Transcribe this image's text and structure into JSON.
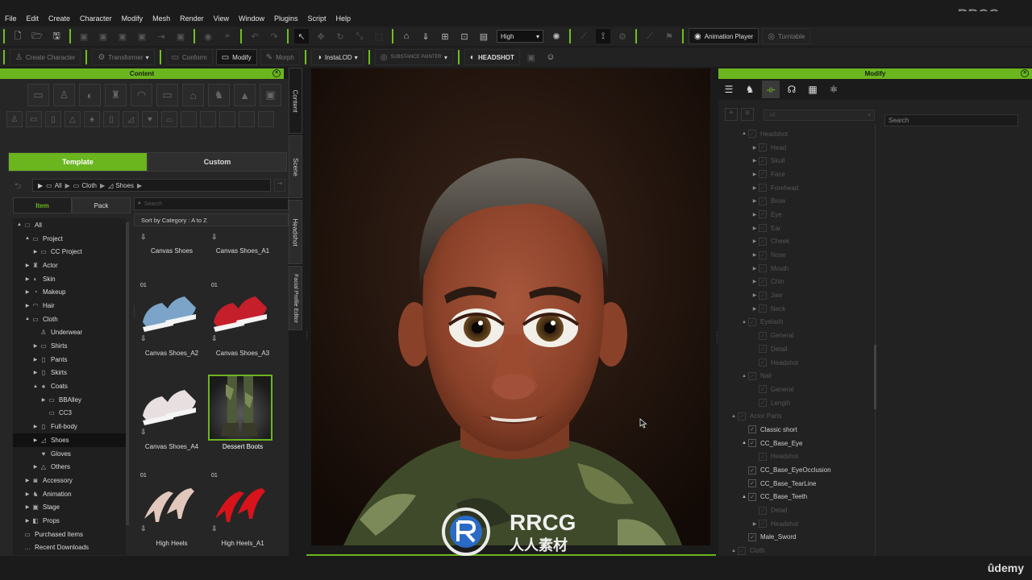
{
  "menu": [
    "File",
    "Edit",
    "Create",
    "Character",
    "Modify",
    "Mesh",
    "Render",
    "View",
    "Window",
    "Plugins",
    "Script",
    "Help"
  ],
  "watermark": "RRCG.cn",
  "toolbar": {
    "quality": "High",
    "animation_player": "Animation Player",
    "turntable": "Turntable",
    "create_character": "Create Character",
    "transformer": "Transformer",
    "conform": "Conform",
    "modify": "Modify",
    "morph": "Morph",
    "instalod": "InstaLOD",
    "substance": "SUBSTANCE PAINTER",
    "headshot": "HEADSHOT"
  },
  "content": {
    "title": "Content",
    "tabs": [
      "Template",
      "Custom"
    ],
    "breadcrumb": [
      "All",
      "Cloth",
      "Shoes"
    ],
    "subtabs": [
      "Item",
      "Pack"
    ],
    "search_placeholder": "Search",
    "sort": "Sort by Category : A to Z",
    "tree": [
      {
        "label": "All",
        "depth": 0,
        "arrow": "▲",
        "icon": "□"
      },
      {
        "label": "Project",
        "depth": 1,
        "arrow": "▲",
        "icon": "▭"
      },
      {
        "label": "CC Project",
        "depth": 2,
        "arrow": "▶",
        "icon": "▭"
      },
      {
        "label": "Actor",
        "depth": 1,
        "arrow": "▶",
        "icon": "♜"
      },
      {
        "label": "Skin",
        "depth": 1,
        "arrow": "▶",
        "icon": "◐"
      },
      {
        "label": "Makeup",
        "depth": 1,
        "arrow": "▶",
        "icon": "◔"
      },
      {
        "label": "Hair",
        "depth": 1,
        "arrow": "▶",
        "icon": "◠"
      },
      {
        "label": "Cloth",
        "depth": 1,
        "arrow": "▲",
        "icon": "▭"
      },
      {
        "label": "Underwear",
        "depth": 2,
        "arrow": "",
        "icon": "♙"
      },
      {
        "label": "Shirts",
        "depth": 2,
        "arrow": "▶",
        "icon": "▭"
      },
      {
        "label": "Pants",
        "depth": 2,
        "arrow": "▶",
        "icon": "▯"
      },
      {
        "label": "Skirts",
        "depth": 2,
        "arrow": "▶",
        "icon": "▯"
      },
      {
        "label": "Coats",
        "depth": 2,
        "arrow": "▲",
        "icon": "♠"
      },
      {
        "label": "BBAlley",
        "depth": 3,
        "arrow": "▶",
        "icon": "▭"
      },
      {
        "label": "CC3",
        "depth": 3,
        "arrow": "",
        "icon": "▭"
      },
      {
        "label": "Full-body",
        "depth": 2,
        "arrow": "▶",
        "icon": "▯"
      },
      {
        "label": "Shoes",
        "depth": 2,
        "arrow": "▶",
        "icon": "◿",
        "selected": true
      },
      {
        "label": "Gloves",
        "depth": 2,
        "arrow": "",
        "icon": "♥"
      },
      {
        "label": "Others",
        "depth": 2,
        "arrow": "▶",
        "icon": "△"
      },
      {
        "label": "Accessory",
        "depth": 1,
        "arrow": "▶",
        "icon": "◙"
      },
      {
        "label": "Animation",
        "depth": 1,
        "arrow": "▶",
        "icon": "♞"
      },
      {
        "label": "Stage",
        "depth": 1,
        "arrow": "▶",
        "icon": "▣"
      },
      {
        "label": "Props",
        "depth": 1,
        "arrow": "▶",
        "icon": "◧"
      },
      {
        "label": "Purchased Items",
        "depth": 0,
        "arrow": "",
        "icon": "▭"
      },
      {
        "label": "Recent Downloads",
        "depth": 0,
        "arrow": "",
        "icon": "…"
      }
    ],
    "items": [
      {
        "label": "Canvas Shoes",
        "num": "",
        "color": "#ddd",
        "col": 0,
        "row": 0
      },
      {
        "label": "Canvas Shoes_A1",
        "num": "",
        "color": "#ddd",
        "col": 1,
        "row": 0
      },
      {
        "label": "Canvas Shoes_A2",
        "num": "01",
        "color": "#7ba4c8",
        "col": 0,
        "row": 1
      },
      {
        "label": "Canvas Shoes_A3",
        "num": "01",
        "color": "#c41f2a",
        "col": 1,
        "row": 1
      },
      {
        "label": "Canvas Shoes_A4",
        "num": "",
        "color": "#e8dfe0",
        "col": 0,
        "row": 2
      },
      {
        "label": "Dessert Boots",
        "num": "",
        "color": "#4e5b38",
        "col": 1,
        "row": 2,
        "selected": true
      },
      {
        "label": "High Heels",
        "num": "01",
        "color": "#e2c7bc",
        "col": 0,
        "row": 3
      },
      {
        "label": "High Heels_A1",
        "num": "01",
        "color": "#d8131b",
        "col": 1,
        "row": 3
      }
    ]
  },
  "vtabs": [
    "Content",
    "Scene",
    "Headshot",
    "Facial Profile Editor"
  ],
  "modify": {
    "title": "Modify",
    "filter": "All",
    "search_placeholder": "Search",
    "tree": [
      {
        "label": "Headshot",
        "depth": 1,
        "arrow": "▲",
        "dim": true
      },
      {
        "label": "Head",
        "depth": 2,
        "arrow": "▶",
        "dim": true
      },
      {
        "label": "Skull",
        "depth": 2,
        "arrow": "▶",
        "dim": true
      },
      {
        "label": "Face",
        "depth": 2,
        "arrow": "▶",
        "dim": true
      },
      {
        "label": "Forehead",
        "depth": 2,
        "arrow": "▶",
        "dim": true
      },
      {
        "label": "Brow",
        "depth": 2,
        "arrow": "▶",
        "dim": true
      },
      {
        "label": "Eye",
        "depth": 2,
        "arrow": "▶",
        "dim": true
      },
      {
        "label": "Ear",
        "depth": 2,
        "arrow": "▶",
        "dim": true
      },
      {
        "label": "Cheek",
        "depth": 2,
        "arrow": "▶",
        "dim": true
      },
      {
        "label": "Nose",
        "depth": 2,
        "arrow": "▶",
        "dim": true
      },
      {
        "label": "Mouth",
        "depth": 2,
        "arrow": "▶",
        "dim": true
      },
      {
        "label": "Chin",
        "depth": 2,
        "arrow": "▶",
        "dim": true
      },
      {
        "label": "Jaw",
        "depth": 2,
        "arrow": "▶",
        "dim": true
      },
      {
        "label": "Neck",
        "depth": 2,
        "arrow": "▶",
        "dim": true
      },
      {
        "label": "Eyelash",
        "depth": 1,
        "arrow": "▲",
        "dim": true
      },
      {
        "label": "General",
        "depth": 2,
        "arrow": "",
        "dim": true
      },
      {
        "label": "Detail",
        "depth": 2,
        "arrow": "",
        "dim": true
      },
      {
        "label": "Headshot",
        "depth": 2,
        "arrow": "",
        "dim": true
      },
      {
        "label": "Nail",
        "depth": 1,
        "arrow": "▲",
        "dim": true
      },
      {
        "label": "General",
        "depth": 2,
        "arrow": "",
        "dim": true
      },
      {
        "label": "Length",
        "depth": 2,
        "arrow": "",
        "dim": true
      },
      {
        "label": "Actor Parts",
        "depth": 0,
        "arrow": "▲",
        "dim": true
      },
      {
        "label": "Classic short",
        "depth": 1,
        "arrow": "",
        "dim": false
      },
      {
        "label": "CC_Base_Eye",
        "depth": 1,
        "arrow": "▲",
        "dim": false
      },
      {
        "label": "Headshot",
        "depth": 2,
        "arrow": "",
        "dim": true
      },
      {
        "label": "CC_Base_EyeOcclusion",
        "depth": 1,
        "arrow": "",
        "dim": false
      },
      {
        "label": "CC_Base_TearLine",
        "depth": 1,
        "arrow": "",
        "dim": false
      },
      {
        "label": "CC_Base_Teeth",
        "depth": 1,
        "arrow": "▲",
        "dim": false
      },
      {
        "label": "Detail",
        "depth": 2,
        "arrow": "",
        "dim": true
      },
      {
        "label": "Headshot",
        "depth": 2,
        "arrow": "▶",
        "dim": true
      },
      {
        "label": "Male_Sword",
        "depth": 1,
        "arrow": "",
        "dim": false
      },
      {
        "label": "Cloth",
        "depth": 0,
        "arrow": "▲",
        "dim": true
      }
    ]
  },
  "udemy": "ûdemy",
  "logo": {
    "main": "RRCG",
    "sub": "人人素材"
  },
  "colors": {
    "accent": "#6bb51f"
  }
}
